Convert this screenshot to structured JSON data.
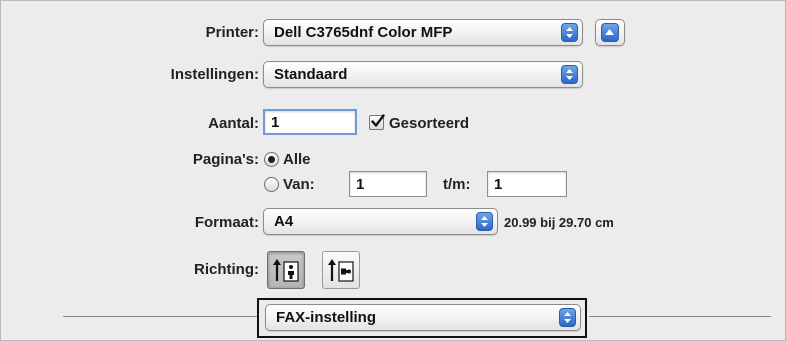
{
  "printer": {
    "label": "Printer:",
    "value": "Dell C3765dnf Color MFP"
  },
  "settings": {
    "label": "Instellingen:",
    "value": "Standaard"
  },
  "copies": {
    "label": "Aantal:",
    "value": "1",
    "collate_label": "Gesorteerd",
    "collate_checked": true
  },
  "pages": {
    "label": "Pagina's:",
    "all_label": "Alle",
    "from_label": "Van:",
    "from_value": "1",
    "to_label": "t/m:",
    "to_value": "1",
    "selected": "all"
  },
  "paper_size": {
    "label": "Formaat:",
    "value": "A4",
    "dimensions": "20.99 bij 29.70 cm"
  },
  "orientation": {
    "label": "Richting:",
    "selected": "portrait"
  },
  "panel": {
    "value": "FAX-instelling"
  },
  "colors": {
    "accent": "#2a67c9",
    "dialog_bg": "#ececec"
  },
  "icons": [
    "disclosure-triangle-icon",
    "popup-arrows-icon",
    "checkmark-icon",
    "portrait-icon",
    "landscape-icon"
  ]
}
